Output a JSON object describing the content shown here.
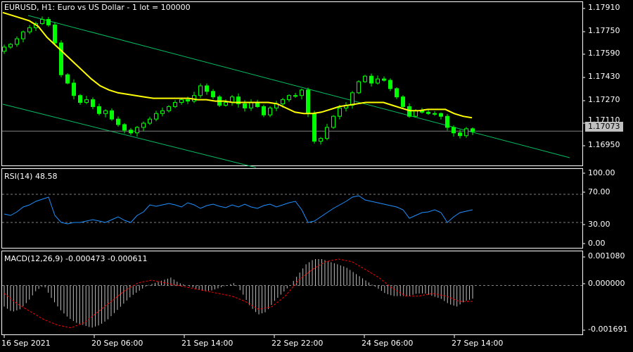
{
  "main_title": "EURUSD, H1:  Euro vs US Dollar - 1 lot = 100000",
  "price_ticks": [
    "1.17910",
    "1.17750",
    "1.17590",
    "1.17430",
    "1.17270",
    "1.17110",
    "1.16950"
  ],
  "current_price": "1.17073",
  "rsi_title": "RSI(14) 48.58",
  "rsi_ticks": [
    "100.00",
    "70.00",
    "30.00",
    "0.00"
  ],
  "macd_title": "MACD(12,26,9) -0.000473 -0.000611",
  "macd_ticks": [
    "0.001080",
    "0.000000",
    "-0.001691"
  ],
  "time_ticks": [
    "16 Sep 2021",
    "20 Sep 06:00",
    "21 Sep 14:00",
    "22 Sep 22:00",
    "24 Sep 06:00",
    "27 Sep 14:00"
  ],
  "colors": {
    "background": "#000000",
    "candle": "#00ff00",
    "moving_average": "#ffff00",
    "channel": "#00c060",
    "rsi_line": "#1e90ff",
    "macd_histogram": "#c0c0c0",
    "macd_signal": "#ff0000",
    "grid": "#808080",
    "text": "#ffffff"
  },
  "chart_data": [
    {
      "type": "candlestick",
      "title": "EURUSD, H1:  Euro vs US Dollar - 1 lot = 100000",
      "ylim": [
        1.1683,
        1.18
      ],
      "current_price": 1.17073,
      "close": [
        1.1768,
        1.177,
        1.1774,
        1.1779,
        1.1782,
        1.1785,
        1.1788,
        1.1784,
        1.1771,
        1.1748,
        1.1742,
        1.1733,
        1.1728,
        1.173,
        1.1725,
        1.172,
        1.1722,
        1.1716,
        1.1712,
        1.1708,
        1.1706,
        1.171,
        1.1713,
        1.1716,
        1.172,
        1.1722,
        1.1725,
        1.1728,
        1.173,
        1.1729,
        1.1733,
        1.174,
        1.1736,
        1.1732,
        1.1726,
        1.1728,
        1.1732,
        1.1727,
        1.1724,
        1.1728,
        1.1725,
        1.1719,
        1.1724,
        1.1727,
        1.173,
        1.1733,
        1.1733,
        1.1737,
        1.172,
        1.17,
        1.1702,
        1.171,
        1.1718,
        1.1724,
        1.1726,
        1.1735,
        1.1743,
        1.1747,
        1.1742,
        1.1745,
        1.1744,
        1.1738,
        1.1732,
        1.1725,
        1.1718,
        1.1722,
        1.1721,
        1.172,
        1.172,
        1.1718,
        1.171,
        1.1706,
        1.1704,
        1.1709,
        1.1707
      ],
      "moving_average": [
        1.1793,
        1.1791,
        1.1789,
        1.1787,
        1.1783,
        1.1775,
        1.1769,
        1.1763,
        1.1757,
        1.1751,
        1.1745,
        1.174,
        1.1737,
        1.1735,
        1.1734,
        1.1733,
        1.1732,
        1.1731,
        1.1731,
        1.1731,
        1.1731,
        1.1731,
        1.173,
        1.173,
        1.1729,
        1.1729,
        1.1728,
        1.1728,
        1.1728,
        1.1728,
        1.1728,
        1.1727,
        1.1724,
        1.1721,
        1.172,
        1.172,
        1.1721,
        1.1723,
        1.1725,
        1.1726,
        1.1727,
        1.1728,
        1.1728,
        1.1728,
        1.1726,
        1.1724,
        1.1722,
        1.1722,
        1.1723,
        1.1723,
        1.1723,
        1.172,
        1.1718,
        1.1717
      ],
      "ma_x_span": [
        4,
        671
      ]
    },
    {
      "type": "line",
      "title": "RSI(14) 48.58",
      "ylim": [
        0,
        100
      ],
      "levels": [
        70,
        30
      ],
      "values": [
        42,
        40,
        45,
        52,
        55,
        60,
        63,
        66,
        40,
        30,
        28,
        30,
        30,
        32,
        34,
        32,
        30,
        34,
        38,
        33,
        30,
        40,
        45,
        55,
        53,
        55,
        57,
        55,
        52,
        58,
        55,
        50,
        54,
        56,
        53,
        51,
        55,
        52,
        56,
        52,
        50,
        54,
        56,
        52,
        55,
        58,
        60,
        48,
        30,
        32,
        38,
        44,
        50,
        55,
        60,
        66,
        68,
        62,
        60,
        58,
        56,
        54,
        52,
        48,
        36,
        40,
        44,
        45,
        48,
        44,
        30,
        38,
        44,
        46,
        48
      ]
    },
    {
      "type": "bar+line",
      "title": "MACD(12,26,9) -0.000473 -0.000611",
      "ylim": [
        -0.001691,
        0.00108
      ],
      "histogram": [
        -0.0008,
        -0.001,
        -0.0009,
        -0.0006,
        -0.0002,
        0.0,
        -0.0005,
        -0.0009,
        -0.0012,
        -0.0014,
        -0.0015,
        -0.0016,
        -0.0015,
        -0.0013,
        -0.001,
        -0.0007,
        -0.0004,
        -0.0002,
        0.0,
        0.0001,
        0.0002,
        0.0003,
        0.0001,
        0.0,
        -0.0001,
        -0.0002,
        -0.0002,
        -0.0001,
        0.0,
        0.0001,
        -0.0003,
        -0.0008,
        -0.0011,
        -0.001,
        -0.0006,
        -0.0003,
        0.0,
        0.0004,
        0.0008,
        0.001,
        0.001,
        0.0009,
        0.0008,
        0.0007,
        0.0005,
        0.0003,
        0.0001,
        -0.0001,
        -0.0003,
        -0.0004,
        -0.0004,
        -0.0004,
        -0.0003,
        -0.0003,
        -0.0004,
        -0.0005,
        -0.0007,
        -0.0008,
        -0.0006,
        -0.0005
      ],
      "signal": [
        -0.0003,
        -0.0007,
        -0.001,
        -0.0013,
        -0.0015,
        -0.0016,
        -0.0014,
        -0.001,
        -0.0006,
        -0.0002,
        0.0001,
        0.0002,
        0.0001,
        0.0,
        -0.0001,
        -0.0002,
        -0.0003,
        -0.0004,
        -0.0006,
        -0.0009,
        -0.0008,
        -0.0004,
        0.0002,
        0.0006,
        0.0009,
        0.001,
        0.0009,
        0.0006,
        0.0003,
        -0.0001,
        -0.0004,
        -0.0004,
        -0.0003,
        -0.0004,
        -0.0006,
        -0.0006
      ]
    }
  ]
}
